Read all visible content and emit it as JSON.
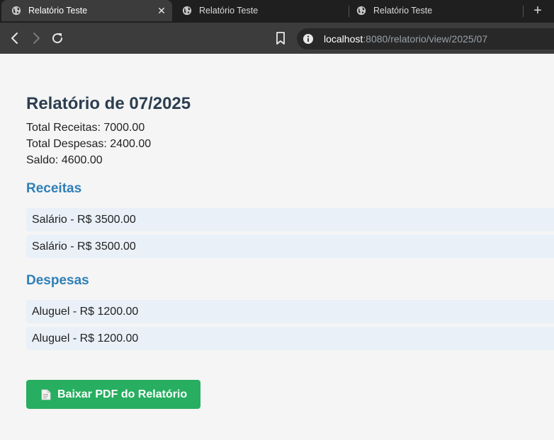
{
  "browser": {
    "tabs": [
      {
        "title": "Relatório Teste",
        "active": true
      },
      {
        "title": "Relatório Teste",
        "active": false
      },
      {
        "title": "Relatório Teste",
        "active": false
      }
    ],
    "url_host": "localhost",
    "url_rest": ":8080/relatorio/view/2025/07",
    "icons": {
      "back": "back-arrow-icon",
      "forward": "forward-arrow-icon",
      "reload": "reload-icon",
      "bookmark": "bookmark-icon",
      "site_info": "info-icon",
      "tab_favicon": "globe-icon",
      "new_tab": "plus-icon",
      "close_tab": "close-icon"
    }
  },
  "report": {
    "title": "Relatório de 07/2025",
    "total_receitas": "Total Receitas: 7000.00",
    "total_despesas": "Total Despesas: 2400.00",
    "saldo": "Saldo: 4600.00",
    "receitas_heading": "Receitas",
    "receitas": [
      "Salário - R$ 3500.00",
      "Salário - R$ 3500.00"
    ],
    "despesas_heading": "Despesas",
    "despesas": [
      "Aluguel - R$ 1200.00",
      "Aluguel - R$ 1200.00"
    ],
    "pdf_button_label": "Baixar PDF do Relatório"
  },
  "colors": {
    "heading": "#2c3e50",
    "section_heading": "#2f7fb7",
    "item_background": "#e9f0f8",
    "pdf_button": "#27ae60",
    "page_background": "#f5f5f5"
  }
}
